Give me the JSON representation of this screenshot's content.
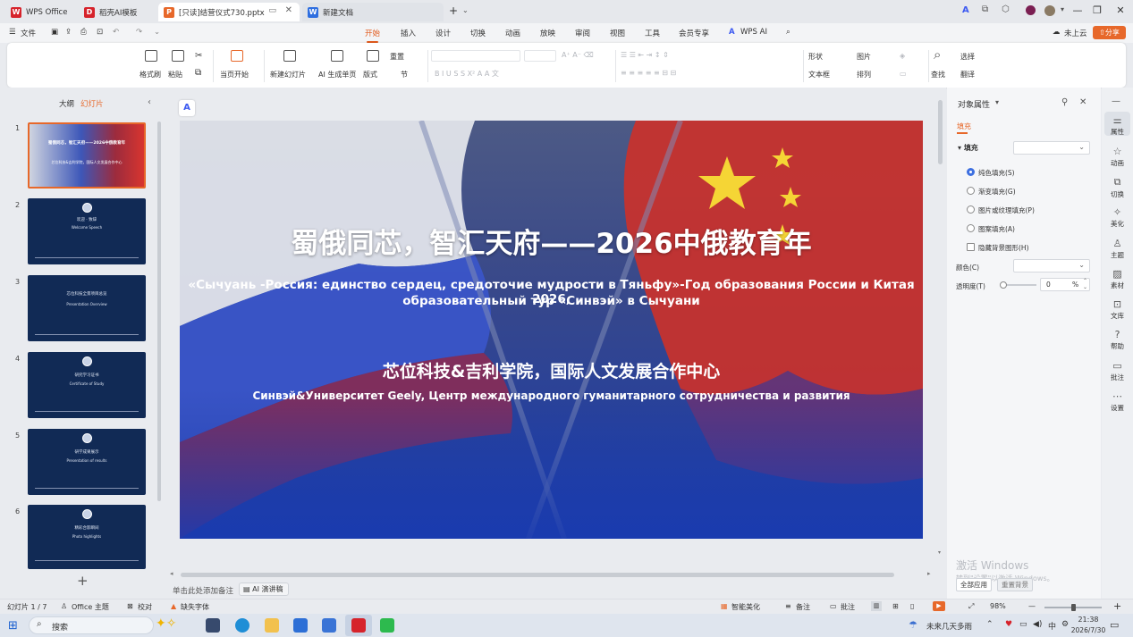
{
  "tabs": [
    {
      "label": "WPS Office",
      "color": "#d6232b",
      "glyph": "W"
    },
    {
      "label": "稻壳AI模板",
      "color": "#d6232b",
      "glyph": "D"
    },
    {
      "label": "[只读]结营仪式730.pptx",
      "color": "#e7682a",
      "glyph": "P"
    },
    {
      "label": "新建文档",
      "color": "#2f6fe0",
      "glyph": "W"
    }
  ],
  "menu": [
    "文件",
    "开始",
    "插入",
    "设计",
    "切换",
    "动画",
    "放映",
    "审阅",
    "视图",
    "工具",
    "会员专享",
    "WPS AI"
  ],
  "header": {
    "cloud": "未上云",
    "share": "分享"
  },
  "ribbon": {
    "format_brush": "格式刷",
    "paste": "粘贴",
    "from_current": "当页开始",
    "new_slide": "新建幻灯片",
    "ai_slide": "AI 生成单页",
    "layout": "版式",
    "reset": "重置",
    "section": "节",
    "shape": "形状",
    "picture": "图片",
    "textbox": "文本框",
    "arrange": "排列",
    "find": "查找",
    "select": "选择",
    "translate": "翻译"
  },
  "left_panel": {
    "tab_outline": "大纲",
    "tab_slides": "幻灯片",
    "numbers": [
      "1",
      "2",
      "3",
      "4",
      "5",
      "6"
    ]
  },
  "thumbs": [
    {
      "l1": "",
      "l2": ""
    },
    {
      "l1": "欢迎 · 致辞",
      "l2": "Welcome Speech"
    },
    {
      "l1": "芯位科技全景项目总览",
      "l2": "Presentation Overview"
    },
    {
      "l1": "研究学习证书",
      "l2": "Certificate of Study"
    },
    {
      "l1": "研学成果展示",
      "l2": "Presentation of results"
    },
    {
      "l1": "精彩合影瞬间",
      "l2": "Photo highlights"
    }
  ],
  "slide": {
    "title": "蜀俄同芯，智汇天府——2026中俄教育年",
    "subtitle_ru_1": "«Сычуань -Россия: единство сердец, средоточие мудрости в Тяньфу»-Год образования России и Китая 2026,",
    "subtitle_ru_2": "образовательный тур «Синвэй» в Сычуани",
    "org_cn": "芯位科技&吉利学院，国际人文发展合作中心",
    "org_ru": "Синвэй&Университет Geely, Центр международного гуманитарного сотрудничества и развития"
  },
  "notes": {
    "placeholder": "单击此处添加备注",
    "ai_speech": "AI 演讲稿"
  },
  "right_panel": {
    "title": "对象属性",
    "tab": "填充",
    "section": "填充",
    "options": [
      "纯色填充(S)",
      "渐变填充(G)",
      "图片或纹理填充(P)",
      "图案填充(A)"
    ],
    "hide_bg": "隐藏背景图形(H)",
    "color_label": "颜色(C)",
    "transparency_label": "透明度(T)",
    "transparency_value": "0",
    "percent": "%",
    "apply_all": "全部应用",
    "reset_bg": "重置背景",
    "watermark_1": "激活 Windows",
    "watermark_2": "转到\"设置\"以激活 Windows。"
  },
  "right_bar": [
    "属性",
    "动画",
    "切换",
    "美化",
    "主题",
    "素材",
    "文库",
    "帮助",
    "批注",
    "设置"
  ],
  "status": {
    "slide_index": "幻灯片 1 / 7",
    "theme": "Office 主题",
    "proof": "校对",
    "missing_font": "缺失字体",
    "smart_beautify": "智能美化",
    "notes": "备注",
    "comments": "批注",
    "zoom": "98%"
  },
  "taskbar": {
    "search": "搜索",
    "weather": "未来几天多雨",
    "ime": "中",
    "time": "21:38",
    "date": "2026/7/30"
  }
}
